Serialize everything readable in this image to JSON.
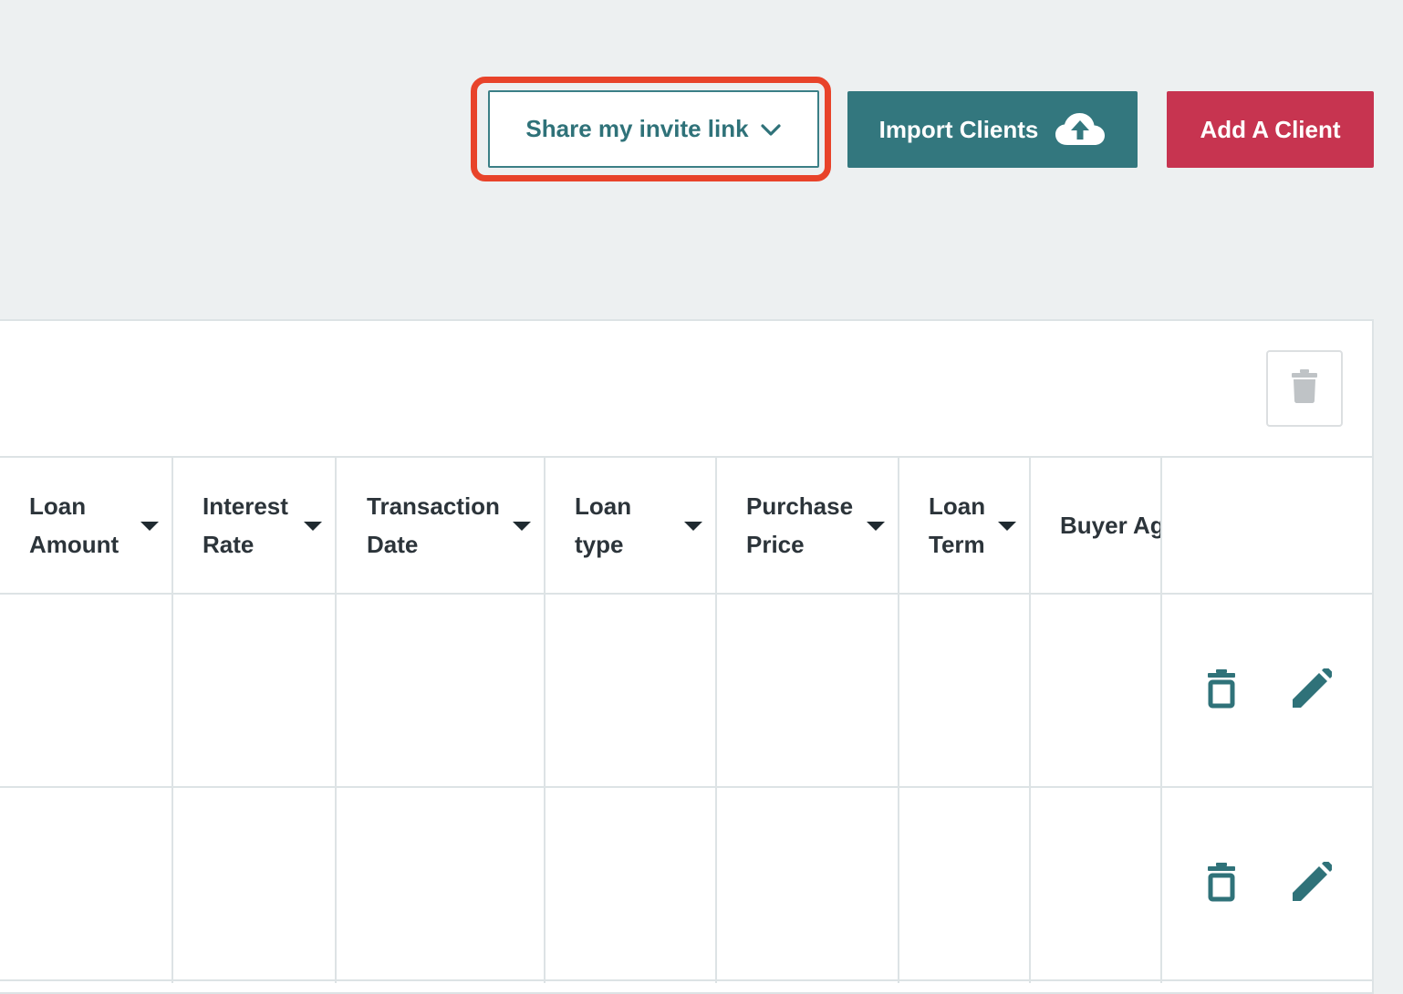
{
  "actions": {
    "share_label": "Share my invite link",
    "import_label": "Import Clients",
    "add_label": "Add A Client"
  },
  "table": {
    "columns": [
      {
        "label": "Loan\nAmount",
        "sortable": true
      },
      {
        "label": "Interest\nRate",
        "sortable": true
      },
      {
        "label": "Transaction\nDate",
        "sortable": true
      },
      {
        "label": "Loan\ntype",
        "sortable": true
      },
      {
        "label": "Purchase\nPrice",
        "sortable": true
      },
      {
        "label": "Loan\nTerm",
        "sortable": true
      },
      {
        "label": "Buyer Ag",
        "sortable": false
      }
    ],
    "rows": [
      {
        "actions": [
          "trash-icon",
          "pencil-icon"
        ]
      },
      {
        "actions": [
          "trash-icon",
          "pencil-icon"
        ]
      }
    ]
  },
  "colors": {
    "teal": "#33777e",
    "teal_text": "#2f7279",
    "red": "#c73450",
    "highlight": "#e8432a",
    "background": "#edf0f1"
  },
  "icons": {
    "share_chevron": "chevron-down-icon",
    "import_icon": "cloud-upload-icon",
    "bulk_delete": "trash-icon",
    "row_delete": "trash-outline-icon",
    "row_edit": "pencil-icon"
  }
}
